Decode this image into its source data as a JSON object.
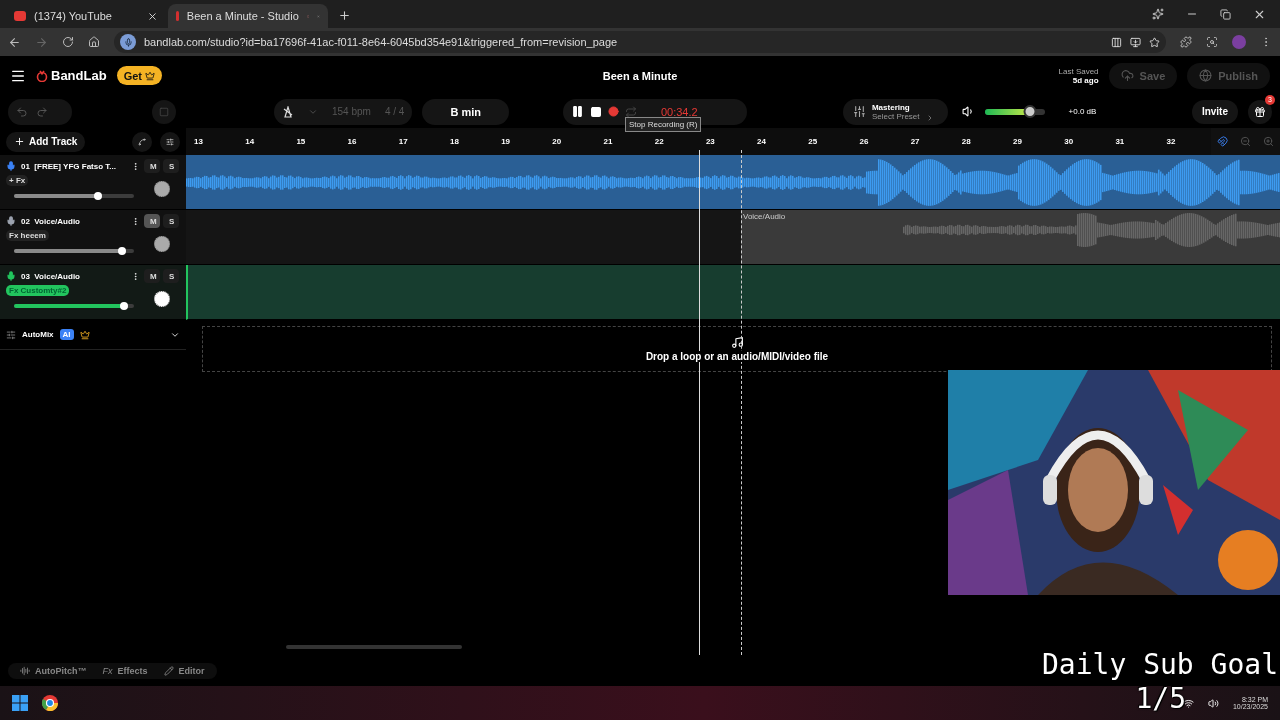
{
  "browser": {
    "tabs": [
      {
        "title": "(1374) YouTube",
        "kind": "youtube",
        "selected": false
      },
      {
        "title": "Been a Minute - Studio",
        "kind": "bandlab",
        "selected": true
      }
    ],
    "address": "bandlab.com/studio?id=ba17696f-41ac-f011-8e64-6045bd354e91&triggered_from=revision_page"
  },
  "header": {
    "logo": "BandLab",
    "get_button": "Get",
    "title": "Been a Minute",
    "last_saved_label": "Last Saved",
    "last_saved_value": "5d ago",
    "save": "Save",
    "publish": "Publish"
  },
  "toolbar": {
    "bpm": "154",
    "bpm_unit": "bpm",
    "time_signature": "4 / 4",
    "key": "B min",
    "time": "00:34.2",
    "tooltip": "Stop Recording (R)",
    "mastering": "Mastering",
    "preset": "Select Preset",
    "volume": {
      "level": 0.75
    },
    "gain": "+0.0 dB",
    "invite": "Invite",
    "gift_count": "3"
  },
  "add_track": "Add Track",
  "ruler": [
    "13",
    "14",
    "15",
    "16",
    "17",
    "18",
    "19",
    "20",
    "21",
    "22",
    "23",
    "24",
    "25",
    "26",
    "27",
    "28",
    "29",
    "30",
    "31",
    "32"
  ],
  "tracks": [
    {
      "number": "01",
      "name": "[FREE] YFG Fatso T...",
      "fx": "+ Fx",
      "fx_active": false,
      "mute_label": "M",
      "solo_label": "S",
      "muted": false,
      "selected": false,
      "level": 0.7,
      "color": "#3b82f6",
      "kind": "waveform"
    },
    {
      "number": "02",
      "name": "Voice/Audio",
      "fx": "Fx heeem",
      "fx_active": false,
      "mute_label": "M",
      "solo_label": "S",
      "muted": true,
      "selected": false,
      "level": 0.9,
      "color": "#9ca3af",
      "kind": "clip",
      "clip_label": "Voice/Audio"
    },
    {
      "number": "03",
      "name": "Voice/Audio",
      "fx": "Fx Customty#2",
      "fx_active": true,
      "mute_label": "M",
      "solo_label": "S",
      "muted": false,
      "selected": true,
      "level": 0.92,
      "color": "#22c55e",
      "kind": "empty"
    }
  ],
  "automix": {
    "label": "AutoMix",
    "badge": "AI"
  },
  "drop_zone": "Drop a loop or an audio/MIDI/video file",
  "bottom_tools": [
    {
      "label": "AutoPitch™",
      "kind": "pitch"
    },
    {
      "label": "Effects",
      "kind": "fx",
      "glyph": "Fx"
    },
    {
      "label": "Editor",
      "kind": "pencil"
    }
  ],
  "overlay": {
    "line_1": "Daily Sub Goal",
    "line_2": "1/5"
  },
  "taskbar": {
    "time": "8:32 PM",
    "date": "10/23/2025"
  }
}
